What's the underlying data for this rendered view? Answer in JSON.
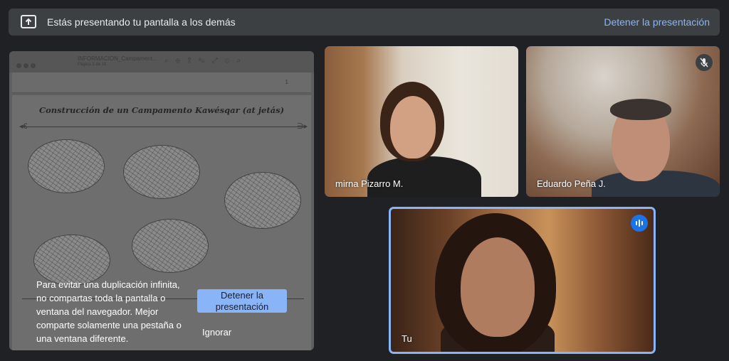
{
  "banner": {
    "text": "Estás presentando tu pantalla a los demás",
    "stop_link": "Detener la presentación",
    "icon": "present-to-all-icon"
  },
  "share_preview": {
    "doc_toolbar_name": "INFORMACION_Campament...",
    "doc_toolbar_pages": "Página 1 de 16",
    "page_number": "1",
    "doc_title": "Construcción de un Campamento Kawésqar (at jetás)",
    "warning": "Para evitar una duplicación infinita, no compartas toda la pantalla o ventana del navegador. Mejor comparte solamente una pestaña o una ventana diferente.",
    "stop_button": "Detener la presentación",
    "ignore_button": "Ignorar"
  },
  "participants": [
    {
      "name": "mirna Pizarro M."
    },
    {
      "name": "Eduardo Peña J.",
      "status_icon": "mic-off-icon"
    },
    {
      "name": "Tu",
      "status_icon": "speaking-icon"
    }
  ],
  "colors": {
    "background": "#202124",
    "banner": "#3c4043",
    "accent": "#8ab4f8"
  }
}
